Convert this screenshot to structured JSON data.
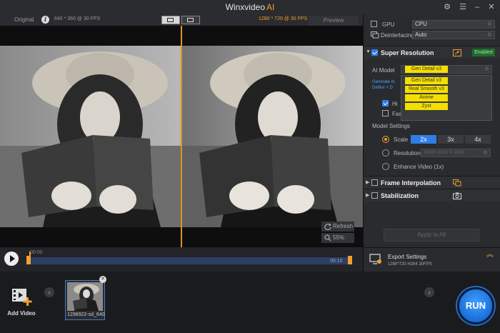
{
  "app": {
    "title": "Winxvideo",
    "title_accent": "AI"
  },
  "preview_header": {
    "original_label": "Original",
    "original_info": "640 * 360 @ 30 FPS",
    "output_info": "1280 * 720 @ 30 FPS",
    "preview_tab": "Preview"
  },
  "video_controls": {
    "refresh_label": "Refresh",
    "zoom_label": "55%"
  },
  "timeline": {
    "start_time": "00:00",
    "end_time": "00:10"
  },
  "panel": {
    "gpu_label": "GPU",
    "gpu_value": "CPU",
    "deinterlacing_label": "Deinterlacing",
    "deinterlacing_value": "Auto",
    "super_resolution": {
      "title": "Super Resolution",
      "badge": "Enabled",
      "ai_model_label": "AI Model",
      "ai_model_value": "Gen Detail v3",
      "dropdown_options": [
        "Gen Detail v3",
        "Real Smooth v3",
        "Anime",
        "Zyxt"
      ],
      "link_line1": "Generate m",
      "link_line2": "Deblur + D",
      "hi_label": "Hi",
      "fast_mode_label": "Fast Mode",
      "model_settings_label": "Model Settings",
      "scale_label": "Scale",
      "scale_options": [
        "2x",
        "3x",
        "4x"
      ],
      "resolution_label": "Resolution",
      "resolution_value": "1080P (1920 X 1080)",
      "enhance_label": "Enhance Video (1x)"
    },
    "frame_interpolation": {
      "title": "Frame Interpolation"
    },
    "stabilization": {
      "title": "Stabilization"
    },
    "apply_label": "Apply to All"
  },
  "export": {
    "title": "Export Settings",
    "details": "1280*720  H264  30FPS"
  },
  "bottom": {
    "add_video_label": "Add Video",
    "thumb_name": "1298922-sd_640",
    "run_label": "RUN"
  },
  "colors": {
    "accent_orange": "#f0a030",
    "blue": "#2f7ee6",
    "enabled_green": "#1f6a2e",
    "dropdown_yellow": "#f5df00"
  }
}
